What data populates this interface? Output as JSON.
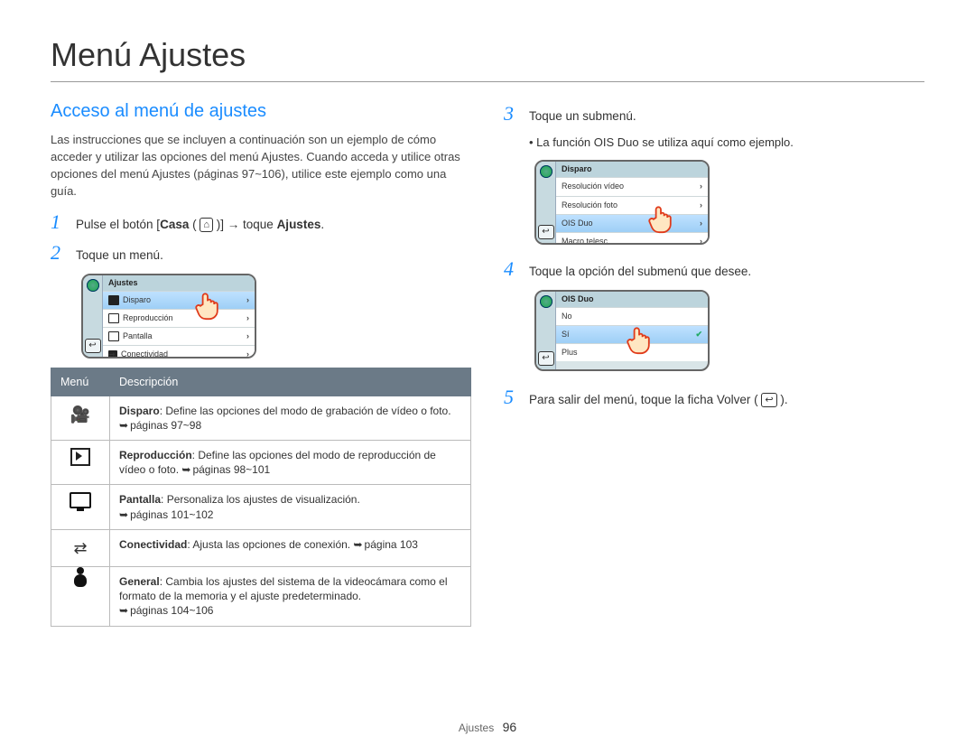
{
  "page_title": "Menú Ajustes",
  "section_title": "Acceso al menú de ajustes",
  "intro": "Las instrucciones que se incluyen a continuación son un ejemplo de cómo acceder y utilizar las opciones del menú Ajustes. Cuando acceda y utilice otras opciones del menú Ajustes (páginas 97~106), utilice este ejemplo como una guía.",
  "steps": {
    "1": {
      "pre": "Pulse el botón [",
      "bold1": "Casa",
      "home_icon": "⌂",
      "mid": " ( ",
      "post": " )] → toque ",
      "bold2": "Ajustes",
      "end": "."
    },
    "2": "Toque un menú.",
    "3": "Toque un submenú.",
    "3_bullet": "La función OIS Duo se utiliza aquí como ejemplo.",
    "4": "Toque la opción del submenú que desee.",
    "5_pre": "Para salir del menú, toque la ficha Volver ( ",
    "5_icon": "↩",
    "5_post": " )."
  },
  "back_glyph": "↩",
  "mock_menu_2": {
    "title": "Ajustes",
    "items": [
      {
        "label": "Disparo",
        "sel": true
      },
      {
        "label": "Reproducción",
        "sel": false
      },
      {
        "label": "Pantalla",
        "sel": false
      },
      {
        "label": "Conectividad",
        "sel": false
      }
    ]
  },
  "mock_menu_3": {
    "title": "Disparo",
    "items": [
      {
        "label": "Resolución vídeo",
        "sel": false
      },
      {
        "label": "Resolución foto",
        "sel": false
      },
      {
        "label": "OIS Duo",
        "sel": true
      },
      {
        "label": "Macro telesc",
        "sel": false
      }
    ]
  },
  "mock_menu_4": {
    "title": "OIS Duo",
    "items": [
      {
        "label": "No",
        "sel": false,
        "check": false
      },
      {
        "label": "Sí",
        "sel": true,
        "check": true
      },
      {
        "label": "Plus",
        "sel": false,
        "check": false
      }
    ]
  },
  "table": {
    "head_menu": "Menú",
    "head_desc": "Descripción",
    "rows": [
      {
        "bold": "Disparo",
        "text": ": Define las opciones del modo de grabación de vídeo o foto. ",
        "pages": "páginas 97~98"
      },
      {
        "bold": "Reproducción",
        "text": ": Define las opciones del modo de reproducción de vídeo o foto. ",
        "pages": "páginas 98~101"
      },
      {
        "bold": "Pantalla",
        "text": ": Personaliza los ajustes de visualización.",
        "pages": "páginas 101~102"
      },
      {
        "bold": "Conectividad",
        "text": ": Ajusta las opciones de conexión. ",
        "pages": "página 103"
      },
      {
        "bold": "General",
        "text": ": Cambia los ajustes del sistema de la videocámara como el formato de la memoria y el ajuste predeterminado.",
        "pages": "páginas 104~106"
      }
    ]
  },
  "footer_section": "Ajustes",
  "footer_page": "96"
}
